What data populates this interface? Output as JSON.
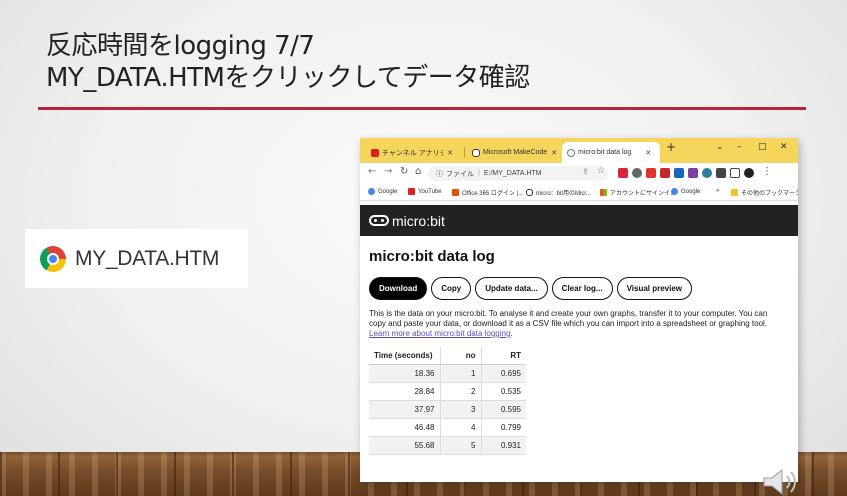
{
  "slide": {
    "title_line1": "反応時間をlogging 7/7",
    "title_line2": "MY_DATA.HTMをクリックしてデータ確認",
    "accent_color": "#b0283a",
    "file_badge": {
      "label": "MY_DATA.HTM",
      "icon": "chrome-icon"
    }
  },
  "browser": {
    "tabs": [
      {
        "label": "チャンネル アナリティクス - Y",
        "icon": "youtube-icon"
      },
      {
        "label": "Microsoft MakeCode",
        "icon": "makecode-icon"
      },
      {
        "label": "micro:bit data log",
        "icon": "globe-icon",
        "active": true
      }
    ],
    "new_tab": "+",
    "window_controls": {
      "chevron": "⌄",
      "minimize": "–",
      "maximize": "□",
      "close": "✕"
    },
    "address": {
      "scheme_label": "ファイル",
      "path": "E:/MY_DATA.HTM"
    },
    "bookmarks": [
      {
        "label": "Google",
        "icon": "google-icon"
      },
      {
        "label": "YouTube",
        "icon": "youtube-icon"
      },
      {
        "label": "Office 365 ログイン |...",
        "icon": "office-icon"
      },
      {
        "label": "micro：bit用のMicr...",
        "icon": "microbit-icon"
      },
      {
        "label": "アカウントにサインイン",
        "icon": "microsoft-icon"
      },
      {
        "label": "Google",
        "icon": "google-icon"
      }
    ],
    "bookmarks_overflow": "»",
    "other_bookmarks": "その他のブックマーク"
  },
  "page": {
    "brand": "micro:bit",
    "title": "micro:bit data log",
    "buttons": {
      "download": "Download",
      "copy": "Copy",
      "update": "Update data...",
      "clear": "Clear log...",
      "visual": "Visual preview"
    },
    "description": "This is the data on your micro:bit. To analyse it and create your own graphs, transfer it to your computer. You can copy and paste your data, or download it as a CSV file which you can import into a spreadsheet or graphing tool.",
    "learn_more": "Learn more about micro:bit data logging",
    "table": {
      "headers": [
        "Time (seconds)",
        "no",
        "RT"
      ],
      "rows": [
        [
          "18.36",
          "1",
          "0.695"
        ],
        [
          "28.84",
          "2",
          "0.535"
        ],
        [
          "37.97",
          "3",
          "0.595"
        ],
        [
          "46.48",
          "4",
          "0.799"
        ],
        [
          "55.68",
          "5",
          "0.931"
        ]
      ]
    }
  }
}
